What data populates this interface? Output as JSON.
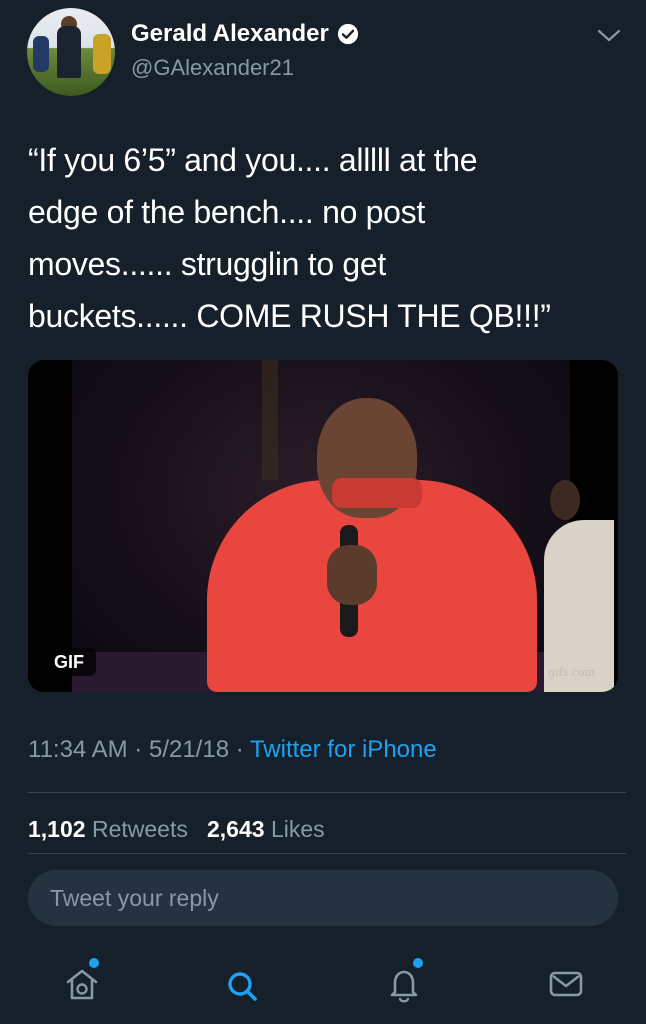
{
  "tweet": {
    "author_name": "Gerald Alexander",
    "author_handle": "@GAlexander21",
    "text_lines": [
      "“If you 6’5” and you.... alllll at the",
      "edge of the bench.... no post",
      "moves...... strugglin to get",
      "buckets...... COME RUSH THE QB!!!”"
    ],
    "media": {
      "badge": "GIF",
      "watermark": "gifs.com"
    },
    "time": "11:34 AM",
    "date": "5/21/18",
    "source": "Twitter for iPhone",
    "retweets_count": "1,102",
    "retweets_label": "Retweets",
    "likes_count": "2,643",
    "likes_label": "Likes"
  },
  "reply": {
    "placeholder": "Tweet your reply"
  },
  "tabbar": {
    "items": [
      {
        "icon": "home-icon",
        "notification_dot": true
      },
      {
        "icon": "search-icon",
        "active": true
      },
      {
        "icon": "notifications-icon",
        "notification_dot": true
      },
      {
        "icon": "messages-icon"
      }
    ]
  },
  "colors": {
    "background": "#15202b",
    "accent": "#1da1f2",
    "secondary_text": "#8899a6",
    "divider": "#38444d"
  }
}
